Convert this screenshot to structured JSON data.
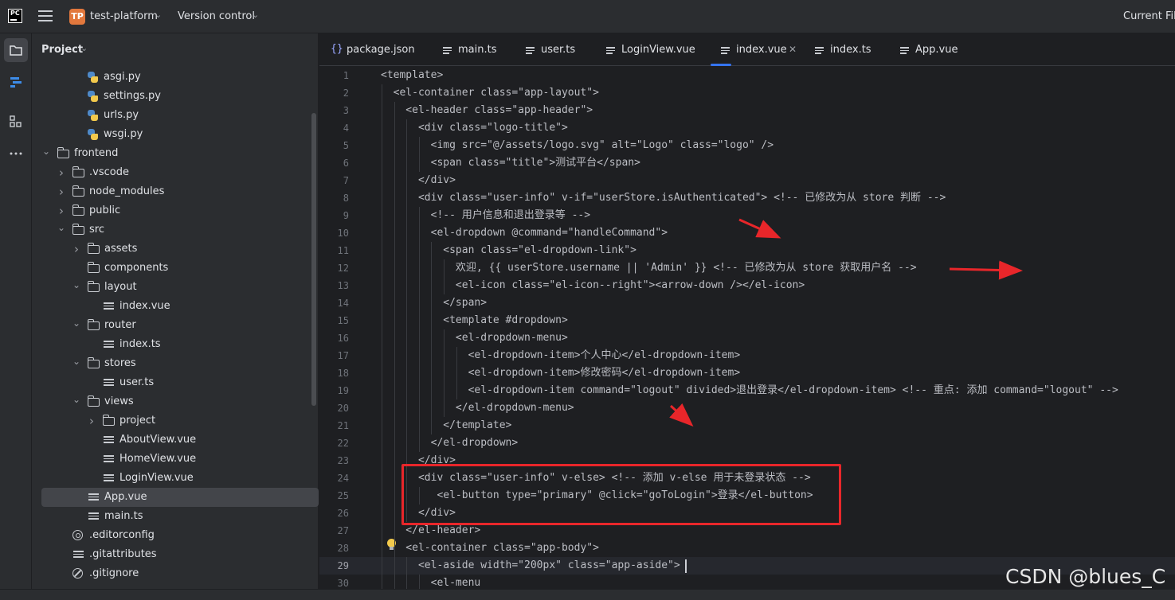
{
  "header": {
    "app_logo": "PC",
    "project_badge": "TP",
    "project_name": "test-platform",
    "vcs_label": "Version control",
    "current_file_label": "Current File"
  },
  "project_panel": {
    "title": "Project",
    "items": [
      {
        "label": "asgi.py",
        "icon": "python-file-icon"
      },
      {
        "label": "settings.py",
        "icon": "python-file-icon"
      },
      {
        "label": "urls.py",
        "icon": "python-file-icon"
      },
      {
        "label": "wsgi.py",
        "icon": "python-file-icon"
      },
      {
        "label": "frontend",
        "icon": "folder-icon",
        "expanded": true
      },
      {
        "label": ".vscode",
        "icon": "folder-icon",
        "expanded": false
      },
      {
        "label": "node_modules",
        "icon": "folder-icon",
        "expanded": false
      },
      {
        "label": "public",
        "icon": "folder-icon",
        "expanded": false
      },
      {
        "label": "src",
        "icon": "folder-icon",
        "expanded": true
      },
      {
        "label": "assets",
        "icon": "folder-icon",
        "expanded": false
      },
      {
        "label": "components",
        "icon": "folder-icon"
      },
      {
        "label": "layout",
        "icon": "folder-icon",
        "expanded": true
      },
      {
        "label": "index.vue",
        "icon": "file-icon"
      },
      {
        "label": "router",
        "icon": "folder-icon",
        "expanded": true
      },
      {
        "label": "index.ts",
        "icon": "file-icon"
      },
      {
        "label": "stores",
        "icon": "folder-icon",
        "expanded": true
      },
      {
        "label": "user.ts",
        "icon": "file-icon"
      },
      {
        "label": "views",
        "icon": "folder-icon",
        "expanded": true
      },
      {
        "label": "project",
        "icon": "folder-icon",
        "expanded": false
      },
      {
        "label": "AboutView.vue",
        "icon": "file-icon"
      },
      {
        "label": "HomeView.vue",
        "icon": "file-icon"
      },
      {
        "label": "LoginView.vue",
        "icon": "file-icon"
      },
      {
        "label": "App.vue",
        "icon": "file-icon",
        "selected": true
      },
      {
        "label": "main.ts",
        "icon": "file-icon"
      },
      {
        "label": ".editorconfig",
        "icon": "gear-icon"
      },
      {
        "label": ".gitattributes",
        "icon": "file-icon"
      },
      {
        "label": ".gitignore",
        "icon": "ban-icon"
      }
    ]
  },
  "tabs": [
    {
      "label": "package.json",
      "icon": "json-icon"
    },
    {
      "label": "main.ts",
      "icon": "file-icon"
    },
    {
      "label": "user.ts",
      "icon": "file-icon"
    },
    {
      "label": "LoginView.vue",
      "icon": "file-icon"
    },
    {
      "label": "index.vue",
      "icon": "file-icon",
      "active": true
    },
    {
      "label": "index.ts",
      "icon": "file-icon"
    },
    {
      "label": "App.vue",
      "icon": "file-icon"
    }
  ],
  "editor": {
    "lines": [
      {
        "n": "1",
        "text": "<template>"
      },
      {
        "n": "2",
        "text": "  <el-container class=\"app-layout\">"
      },
      {
        "n": "3",
        "text": "    <el-header class=\"app-header\">"
      },
      {
        "n": "4",
        "text": "      <div class=\"logo-title\">"
      },
      {
        "n": "5",
        "text": "        <img src=\"@/assets/logo.svg\" alt=\"Logo\" class=\"logo\" />"
      },
      {
        "n": "6",
        "text": "        <span class=\"title\">测试平台</span>"
      },
      {
        "n": "7",
        "text": "      </div>"
      },
      {
        "n": "8",
        "text": "      <div class=\"user-info\" v-if=\"userStore.isAuthenticated\"> <!-- 已修改为从 store 判断 -->"
      },
      {
        "n": "9",
        "text": "        <!-- 用户信息和退出登录等 -->"
      },
      {
        "n": "10",
        "text": "        <el-dropdown @command=\"handleCommand\">"
      },
      {
        "n": "11",
        "text": "          <span class=\"el-dropdown-link\">"
      },
      {
        "n": "12",
        "text": "            欢迎, {{ userStore.username || 'Admin' }} <!-- 已修改为从 store 获取用户名 -->"
      },
      {
        "n": "13",
        "text": "            <el-icon class=\"el-icon--right\"><arrow-down /></el-icon>"
      },
      {
        "n": "14",
        "text": "          </span>"
      },
      {
        "n": "15",
        "text": "          <template #dropdown>"
      },
      {
        "n": "16",
        "text": "            <el-dropdown-menu>"
      },
      {
        "n": "17",
        "text": "              <el-dropdown-item>个人中心</el-dropdown-item>"
      },
      {
        "n": "18",
        "text": "              <el-dropdown-item>修改密码</el-dropdown-item>"
      },
      {
        "n": "19",
        "text": "              <el-dropdown-item command=\"logout\" divided>退出登录</el-dropdown-item> <!-- 重点: 添加 command=\"logout\" -->"
      },
      {
        "n": "20",
        "text": "            </el-dropdown-menu>"
      },
      {
        "n": "21",
        "text": "          </template>"
      },
      {
        "n": "22",
        "text": "        </el-dropdown>"
      },
      {
        "n": "23",
        "text": "      </div>"
      },
      {
        "n": "24",
        "text": "      <div class=\"user-info\" v-else> <!-- 添加 v-else 用于未登录状态 -->"
      },
      {
        "n": "25",
        "text": "         <el-button type=\"primary\" @click=\"goToLogin\">登录</el-button>"
      },
      {
        "n": "26",
        "text": "      </div>"
      },
      {
        "n": "27",
        "text": "    </el-header>"
      },
      {
        "n": "28",
        "text": "    <el-container class=\"app-body\">"
      },
      {
        "n": "29",
        "text": "      <el-aside width=\"200px\" class=\"app-aside\">"
      },
      {
        "n": "30",
        "text": "        <el-menu"
      }
    ],
    "current_line": "29"
  },
  "watermark": "CSDN @blues_C",
  "colors": {
    "accent": "#3574f0",
    "annotation_red": "#e8262a",
    "background": "#1e1f22",
    "panel": "#2b2d30"
  }
}
